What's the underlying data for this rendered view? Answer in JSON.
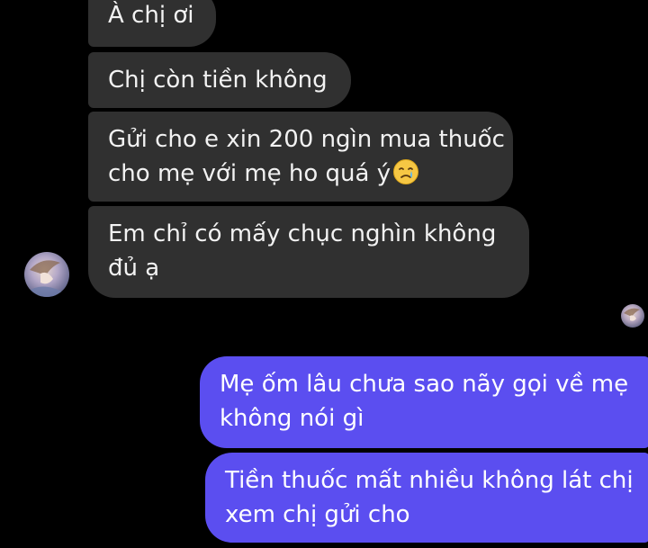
{
  "conversation": {
    "incoming": [
      {
        "lines": [
          "À chị ơi"
        ]
      },
      {
        "lines": [
          "Chị còn tiền không"
        ]
      },
      {
        "lines": [
          "Gửi cho e xin 200 ngìn mua thuốc",
          "cho mẹ với mẹ ho quá ý"
        ],
        "emoji": "crying-face"
      },
      {
        "lines": [
          "Em chỉ có mấy chục nghìn không",
          "đủ ạ"
        ]
      }
    ],
    "outgoing": [
      {
        "lines": [
          "Mẹ ốm lâu chưa sao nãy gọi  về mẹ",
          "không nói gì"
        ]
      },
      {
        "lines": [
          "Tiền thuốc mất nhiều không lát chị",
          "xem chị gửi cho"
        ]
      }
    ]
  },
  "colors": {
    "background": "#000000",
    "incoming_bubble": "#303030",
    "outgoing_bubble": "#5b4ef0",
    "text": "#ffffff"
  },
  "icons": {
    "sender_avatar": "contact-avatar-icon",
    "read_receipt": "read-receipt-avatar-icon",
    "emoji": "crying-face-icon"
  }
}
